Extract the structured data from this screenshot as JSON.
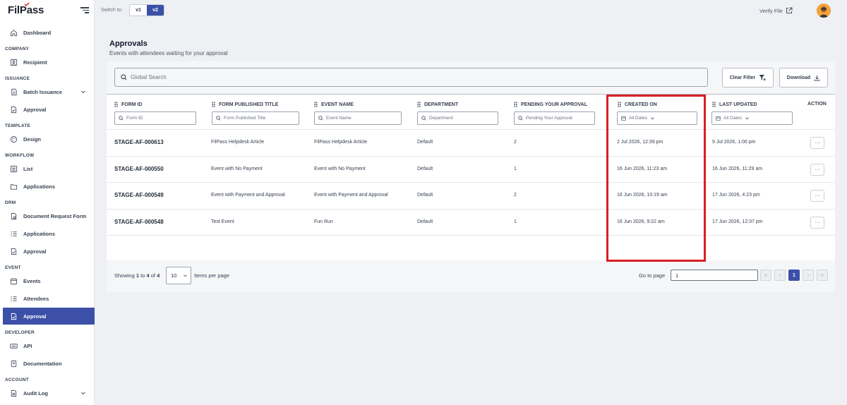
{
  "app": {
    "logo": "FilPass"
  },
  "topbar": {
    "switch_label": "Switch to:",
    "versions": [
      "v1",
      "v2"
    ],
    "verify_label": "Verify File"
  },
  "sidebar": {
    "dashboard": "Dashboard",
    "company": {
      "title": "COMPANY",
      "recipient": "Recipient"
    },
    "issuance": {
      "title": "ISSUANCE",
      "batch": "Batch Issuance",
      "approval": "Approval"
    },
    "template": {
      "title": "TEMPLATE",
      "design": "Design"
    },
    "workflow": {
      "title": "WORKFLOW",
      "list": "List",
      "applications": "Applications"
    },
    "drm": {
      "title": "DRM",
      "doc_request": "Document Request Form",
      "applications": "Applications",
      "approval": "Approval"
    },
    "event": {
      "title": "EVENT",
      "events": "Events",
      "attendees": "Attendees",
      "approval": "Approval"
    },
    "developer": {
      "title": "DEVELOPER",
      "api": "API",
      "docs": "Documentation"
    },
    "account": {
      "title": "ACCOUNT",
      "audit": "Audit Log"
    }
  },
  "page": {
    "title": "Approvals",
    "subtitle": "Events with attendees waiting for your approval"
  },
  "toolbar": {
    "search_placeholder": "Global Search",
    "clear_filter": "Clear Filter",
    "download": "Download"
  },
  "table": {
    "headers": {
      "form_id": "FORM ID",
      "form_title": "FORM PUBLISHED TITLE",
      "event_name": "EVENT NAME",
      "department": "DEPARTMENT",
      "pending": "PENDING YOUR APPROVAL",
      "created_on": "CREATED ON",
      "last_updated": "LAST UPDATED",
      "action": "ACTION"
    },
    "filters": {
      "form_id": "Form ID",
      "form_title": "Form Published Title",
      "event_name": "Event Name",
      "department": "Department",
      "pending": "Pending Your Approval",
      "created_on": "All Dates",
      "last_updated": "All Dates"
    },
    "rows": [
      {
        "form_id": "STAGE-AF-000613",
        "form_title": "FilPass Helpdesk Article",
        "event_name": "FilPass Helpdesk Article",
        "department": "Default",
        "pending": "2",
        "created_on": "2 Jul 2026, 12:39 pm",
        "last_updated": "9 Jul 2026, 1:00 pm",
        "action": "···"
      },
      {
        "form_id": "STAGE-AF-000550",
        "form_title": "Event with No Payment",
        "event_name": "Event with No Payment",
        "department": "Default",
        "pending": "1",
        "created_on": "16 Jun 2026, 11:23 am",
        "last_updated": "16 Jun 2026, 11:29 am",
        "action": "···"
      },
      {
        "form_id": "STAGE-AF-000549",
        "form_title": "Event with Payment and Approval",
        "event_name": "Event with Payment and Approval",
        "department": "Default",
        "pending": "2",
        "created_on": "16 Jun 2026, 10:19 am",
        "last_updated": "17 Jun 2026, 4:23 pm",
        "action": "···"
      },
      {
        "form_id": "STAGE-AF-000548",
        "form_title": "Test Event",
        "event_name": "Fun Run",
        "department": "Default",
        "pending": "1",
        "created_on": "16 Jun 2026, 9:22 am",
        "last_updated": "17 Jun 2026, 12:37 pm",
        "action": "···"
      }
    ]
  },
  "footer": {
    "showing_prefix": "Showing",
    "from": "1",
    "to_word": "to",
    "to": "4",
    "of_word": "of",
    "total": "4",
    "per_page": "10",
    "per_page_label": "Items per page",
    "goto_label": "Go to page",
    "goto_value": "1",
    "pager": {
      "first": "«",
      "prev": "‹",
      "current": "1",
      "next": "›",
      "last": "»"
    }
  },
  "colors": {
    "accent": "#3c50a8",
    "highlight": "#d61f26"
  }
}
